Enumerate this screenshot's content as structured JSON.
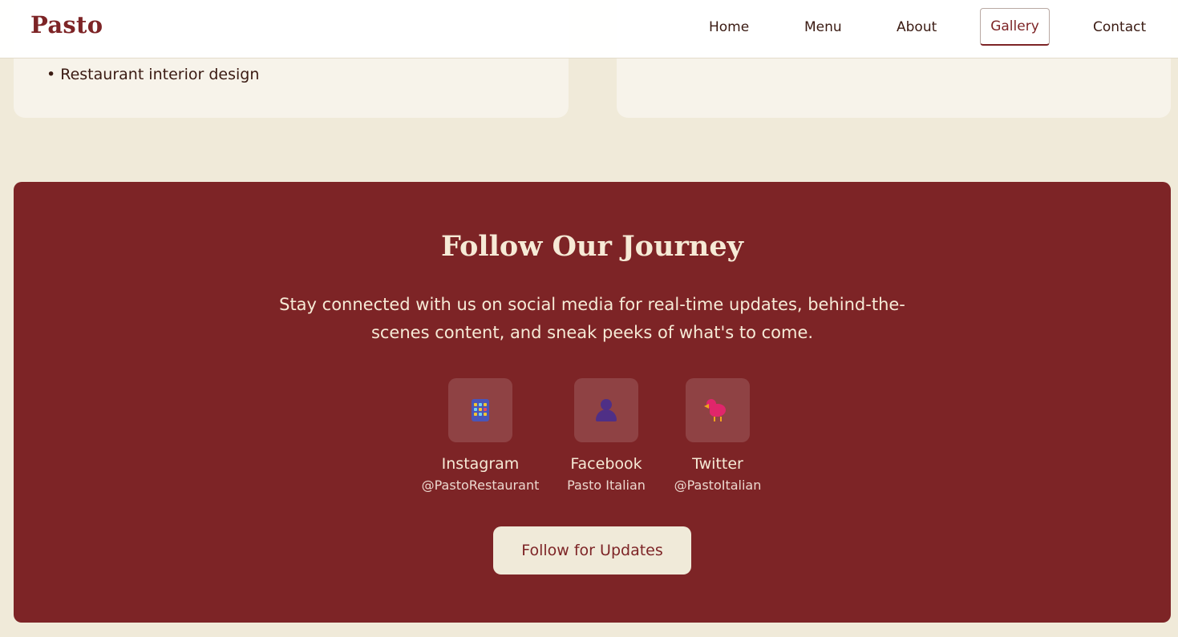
{
  "header": {
    "logo": "Pasto",
    "nav": [
      "Home",
      "Menu",
      "About",
      "Gallery",
      "Contact"
    ],
    "active_nav": "Gallery"
  },
  "previous_section": {
    "left_card_bullet": "• Restaurant interior design"
  },
  "follow": {
    "title": "Follow Our Journey",
    "text": "Stay connected with us on social media for real-time updates, behind-the-scenes content, and sneak peeks of what's to come.",
    "socials": [
      {
        "name": "Instagram",
        "handle": "@PastoRestaurant",
        "icon": "building-icon"
      },
      {
        "name": "Facebook",
        "handle": "Pasto Italian",
        "icon": "person-icon"
      },
      {
        "name": "Twitter",
        "handle": "@PastoItalian",
        "icon": "bird-icon"
      }
    ],
    "button_label": "Follow for Updates"
  },
  "colors": {
    "brand": "#7d2426",
    "background": "#f0ead9",
    "card": "#f7f3ea",
    "light_text": "#f6ead6"
  }
}
